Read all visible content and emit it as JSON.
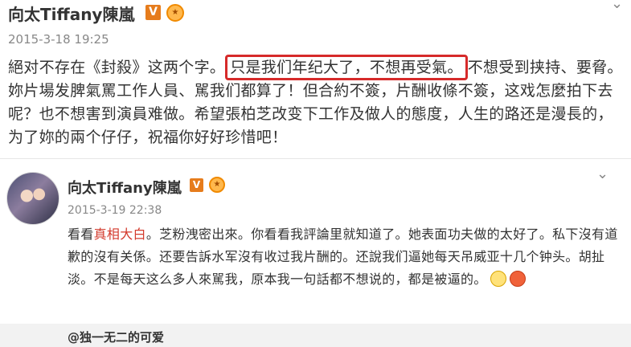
{
  "post1": {
    "username": "向太Tiffany陳嵐",
    "verified_badge": "V",
    "medal_icon": "medal-icon",
    "timestamp": "2015-3-18 19:25",
    "text_before": "絕对不存在《封殺》这两个字。",
    "text_highlight": "只是我们年纪大了，不想再受氣。",
    "text_after": "不想受到挟持、要脅。妳片場发脾氣罵工作人員、駡我们都算了！但合約不簽，片酬收條不簽，这戏怎麼拍下去呢？也不想害到演員难做。希望張柏芝改变下工作及做人的態度，人生的路还是漫長的，为了妳的兩个仔仔，祝福你好好珍惜吧！",
    "highlight_color": "#d62a2a"
  },
  "post2": {
    "username": "向太Tiffany陳嵐",
    "verified_badge": "V",
    "medal_icon": "medal-icon",
    "timestamp": "2015-3-19 22:38",
    "text_prefix": "看看",
    "link_text": "真相大白",
    "text_rest": "。芝粉洩密出來。你看看我評論里就知道了。她表面功夫做的太好了。私下沒有道歉的沒有关係。还要告訴水军沒有收过我片酬的。还說我们逼她每天吊威亚十几个钟头。胡扯淡。不是每天这么多人來駡我，原本我一句話都不想说的，都是被逼的。",
    "emoji_icons": [
      "smile-emoji-icon",
      "angry-emoji-icon"
    ],
    "link_color": "#d33a2c"
  },
  "reply": {
    "username": "@独一无二的可爱"
  },
  "colors": {
    "badge": "#e67c1c",
    "timestamp": "#888888",
    "body_text": "#333333"
  }
}
